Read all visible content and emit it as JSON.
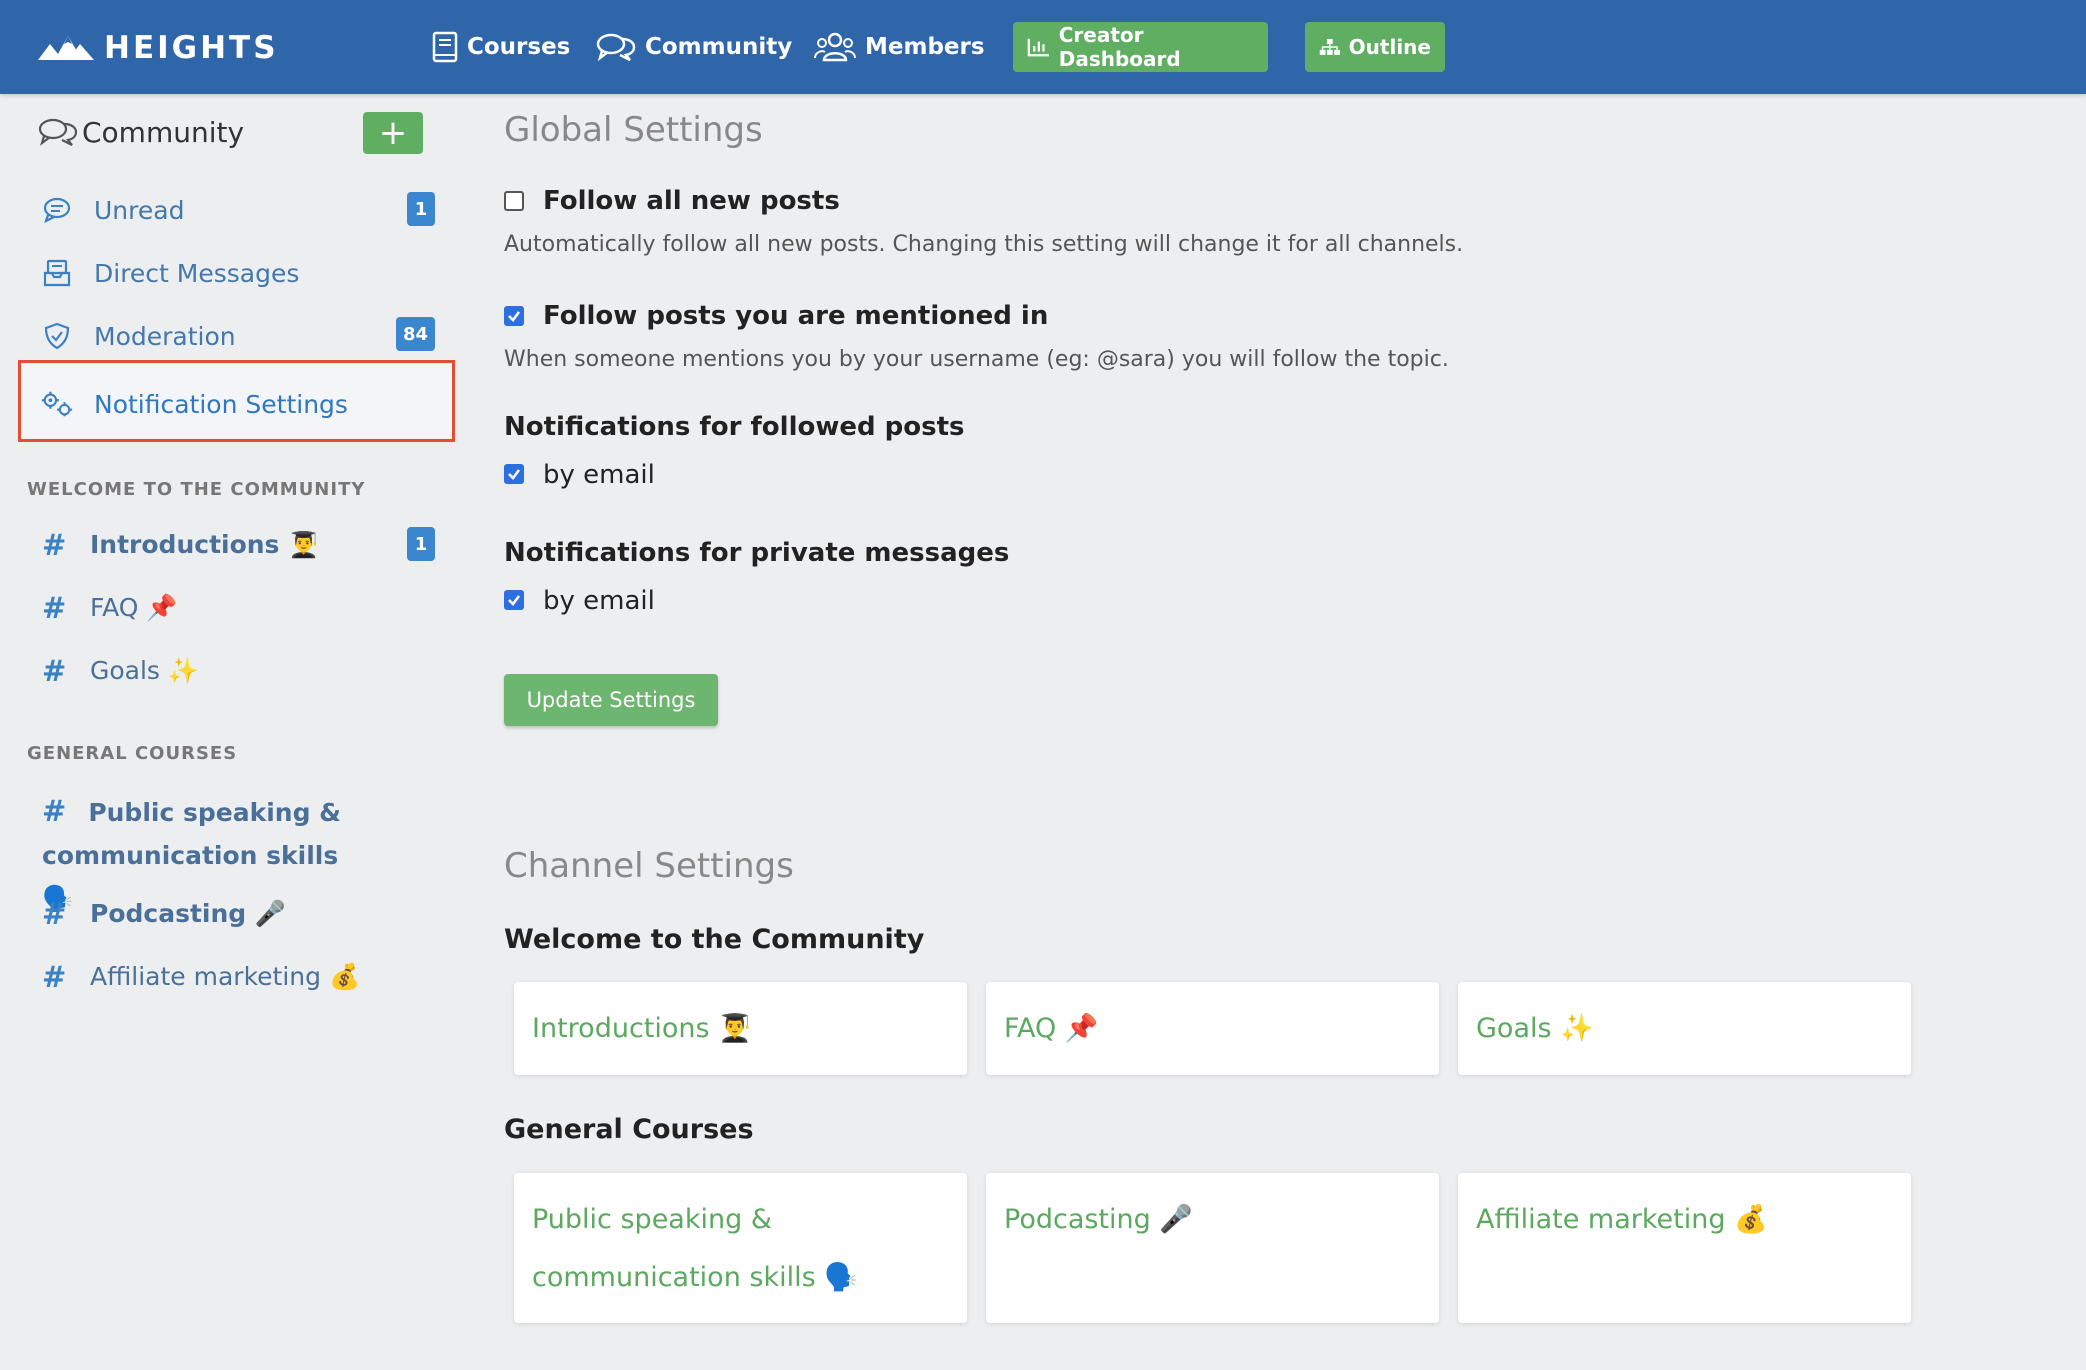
{
  "nav": {
    "brand": "HEIGHTS",
    "links": [
      {
        "label": "Courses",
        "icon": "book-icon"
      },
      {
        "label": "Community",
        "icon": "chat-bubbles-icon"
      },
      {
        "label": "Members",
        "icon": "users-icon"
      }
    ],
    "buttons": [
      {
        "label": "Creator Dashboard",
        "icon": "bar-chart-icon"
      },
      {
        "label": "Outline",
        "icon": "sitemap-icon"
      }
    ]
  },
  "sidebar": {
    "title": "Community",
    "add_label": "+",
    "items": [
      {
        "label": "Unread",
        "icon": "chat-icon",
        "badge": "1"
      },
      {
        "label": "Direct Messages",
        "icon": "inbox-icon",
        "badge": null
      },
      {
        "label": "Moderation",
        "icon": "shield-icon",
        "badge": "84"
      },
      {
        "label": "Notification Settings",
        "icon": "gears-icon",
        "badge": null
      }
    ],
    "sections": [
      {
        "title": "WELCOME TO THE COMMUNITY",
        "channels": [
          {
            "label": "Introductions 👨‍🎓",
            "badge": "1"
          },
          {
            "label": "FAQ 📌"
          },
          {
            "label": "Goals ✨"
          }
        ]
      },
      {
        "title": "GENERAL COURSES",
        "channels": [
          {
            "label": "Public speaking & communication skills 🗣️"
          },
          {
            "label": "Podcasting 🎤"
          },
          {
            "label": "Affiliate marketing 💰"
          }
        ]
      }
    ]
  },
  "main": {
    "global_heading": "Global Settings",
    "follow_all": {
      "label": "Follow all new posts",
      "desc": "Automatically follow all new posts. Changing this setting will change it for all channels.",
      "checked": false
    },
    "follow_mentioned": {
      "label": "Follow posts you are mentioned in",
      "desc": "When someone mentions you by your username (eg: @sara) you will follow the topic.",
      "checked": true
    },
    "followed_notif": {
      "heading": "Notifications for followed posts",
      "option": "by email",
      "checked": true
    },
    "private_notif": {
      "heading": "Notifications for private messages",
      "option": "by email",
      "checked": true
    },
    "update_button": "Update Settings",
    "channel_heading": "Channel Settings",
    "groups": [
      {
        "title": "Welcome to the Community",
        "cards": [
          "Introductions 👨‍🎓",
          "FAQ 📌",
          "Goals ✨"
        ]
      },
      {
        "title": "General Courses",
        "cards": [
          "Public speaking & communication skills 🗣️",
          "Podcasting 🎤",
          "Affiliate marketing 💰"
        ]
      }
    ]
  },
  "colors": {
    "nav_bg": "#2f65a9",
    "green": "#5fae62",
    "link_blue": "#4477ab",
    "badge_blue": "#3a87d0",
    "highlight_red": "#e24d33"
  }
}
